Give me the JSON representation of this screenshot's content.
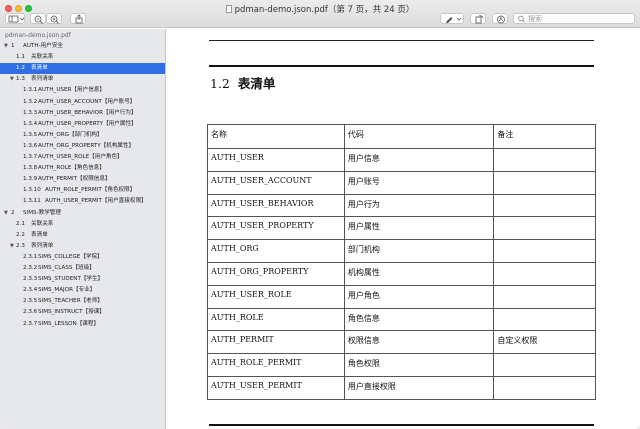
{
  "window": {
    "title": "pdman-demo.json.pdf（第 7 页，共 24 页）"
  },
  "toolbar": {
    "search_placeholder": "搜索"
  },
  "sidebar": {
    "file_name": "pdman-demo.json.pdf",
    "items": [
      {
        "num": "1",
        "label": "AUTH-用户安全",
        "level": 0,
        "expanded": true
      },
      {
        "num": "1.1",
        "label": "关联关系",
        "level": 1
      },
      {
        "num": "1.2",
        "label": "表清单",
        "level": 1,
        "selected": true
      },
      {
        "num": "1.3",
        "label": "表列清单",
        "level": 1,
        "expanded": true
      },
      {
        "num": "1.3.1",
        "label": "AUTH_USER【用户信息】",
        "level": 2
      },
      {
        "num": "1.3.2",
        "label": "AUTH_USER_ACCOUNT【用户账号】",
        "level": 2
      },
      {
        "num": "1.3.3",
        "label": "AUTH_USER_BEHAVIOR【用户行为】",
        "level": 2
      },
      {
        "num": "1.3.4",
        "label": "AUTH_USER_PROPERTY【用户属性】",
        "level": 2
      },
      {
        "num": "1.3.5",
        "label": "AUTH_ORG【部门机构】",
        "level": 2
      },
      {
        "num": "1.3.6",
        "label": "AUTH_ORG_PROPERTY【机构属性】",
        "level": 2
      },
      {
        "num": "1.3.7",
        "label": "AUTH_USER_ROLE【用户角色】",
        "level": 2
      },
      {
        "num": "1.3.8",
        "label": "AUTH_ROLE【角色信息】",
        "level": 2
      },
      {
        "num": "1.3.9",
        "label": "AUTH_PERMIT【权限信息】",
        "level": 2
      },
      {
        "num": "1.3.10",
        "label": "AUTH_ROLE_PERMIT【角色权限】",
        "level": 2
      },
      {
        "num": "1.3.11",
        "label": "AUTH_USER_PERMIT【用户直接权限】",
        "level": 2
      },
      {
        "num": "2",
        "label": "SIMS-教学管理",
        "level": 0,
        "expanded": true
      },
      {
        "num": "2.1",
        "label": "关联关系",
        "level": 1
      },
      {
        "num": "2.2",
        "label": "表清单",
        "level": 1
      },
      {
        "num": "2.3",
        "label": "表列清单",
        "level": 1,
        "expanded": true
      },
      {
        "num": "2.3.1",
        "label": "SIMS_COLLEGE【学院】",
        "level": 2
      },
      {
        "num": "2.3.2",
        "label": "SIMS_CLASS【班级】",
        "level": 2
      },
      {
        "num": "2.3.3",
        "label": "SIMS_STUDENT【学生】",
        "level": 2
      },
      {
        "num": "2.3.4",
        "label": "SIMS_MAJOR【专业】",
        "level": 2
      },
      {
        "num": "2.3.5",
        "label": "SIMS_TEACHER【老师】",
        "level": 2
      },
      {
        "num": "2.3.6",
        "label": "SIMS_INSTRUCT【授课】",
        "level": 2
      },
      {
        "num": "2.3.7",
        "label": "SIMS_LESSON【课程】",
        "level": 2
      }
    ]
  },
  "document": {
    "section_number": "1.2",
    "section_title": "表清单",
    "table": {
      "headers": [
        "名称",
        "代码",
        "备注"
      ],
      "rows": [
        [
          "AUTH_USER",
          "用户信息",
          ""
        ],
        [
          "AUTH_USER_ACCOUNT",
          "用户账号",
          ""
        ],
        [
          "AUTH_USER_BEHAVIOR",
          "用户行为",
          ""
        ],
        [
          "AUTH_USER_PROPERTY",
          "用户属性",
          ""
        ],
        [
          "AUTH_ORG",
          "部门机构",
          ""
        ],
        [
          "AUTH_ORG_PROPERTY",
          "机构属性",
          ""
        ],
        [
          "AUTH_USER_ROLE",
          "用户角色",
          ""
        ],
        [
          "AUTH_ROLE",
          "角色信息",
          ""
        ],
        [
          "AUTH_PERMIT",
          "权限信息",
          "自定义权限"
        ],
        [
          "AUTH_ROLE_PERMIT",
          "角色权限",
          ""
        ],
        [
          "AUTH_USER_PERMIT",
          "用户直接权限",
          ""
        ]
      ]
    }
  }
}
